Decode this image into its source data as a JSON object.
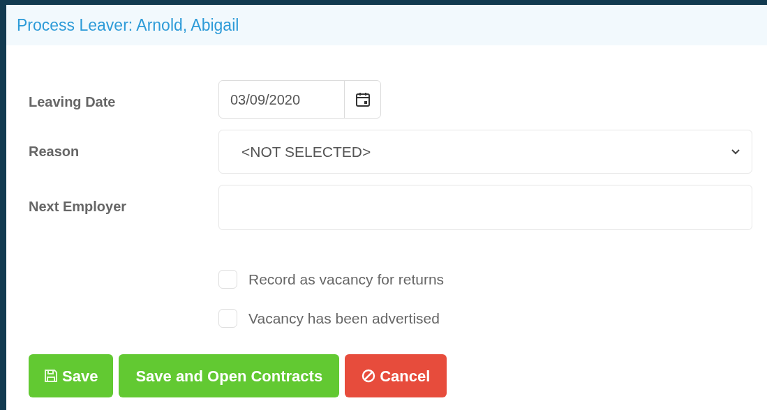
{
  "title": "Process Leaver: Arnold, Abigail",
  "fields": [
    {
      "kind": "date",
      "label": "Leaving Date",
      "value": "03/09/2020"
    },
    {
      "kind": "select",
      "label": "Reason",
      "value": "<NOT SELECTED>"
    },
    {
      "kind": "text",
      "label": "Next Employer"
    }
  ],
  "checkboxes": [
    {
      "label": "Record as vacancy for returns",
      "checked": false
    },
    {
      "label": "Vacancy has been advertised",
      "checked": false
    }
  ],
  "buttons": [
    {
      "kind": "save",
      "label": "Save"
    },
    {
      "kind": "primary",
      "label": "Save and Open Contracts"
    },
    {
      "kind": "cancel",
      "label": "Cancel"
    }
  ]
}
